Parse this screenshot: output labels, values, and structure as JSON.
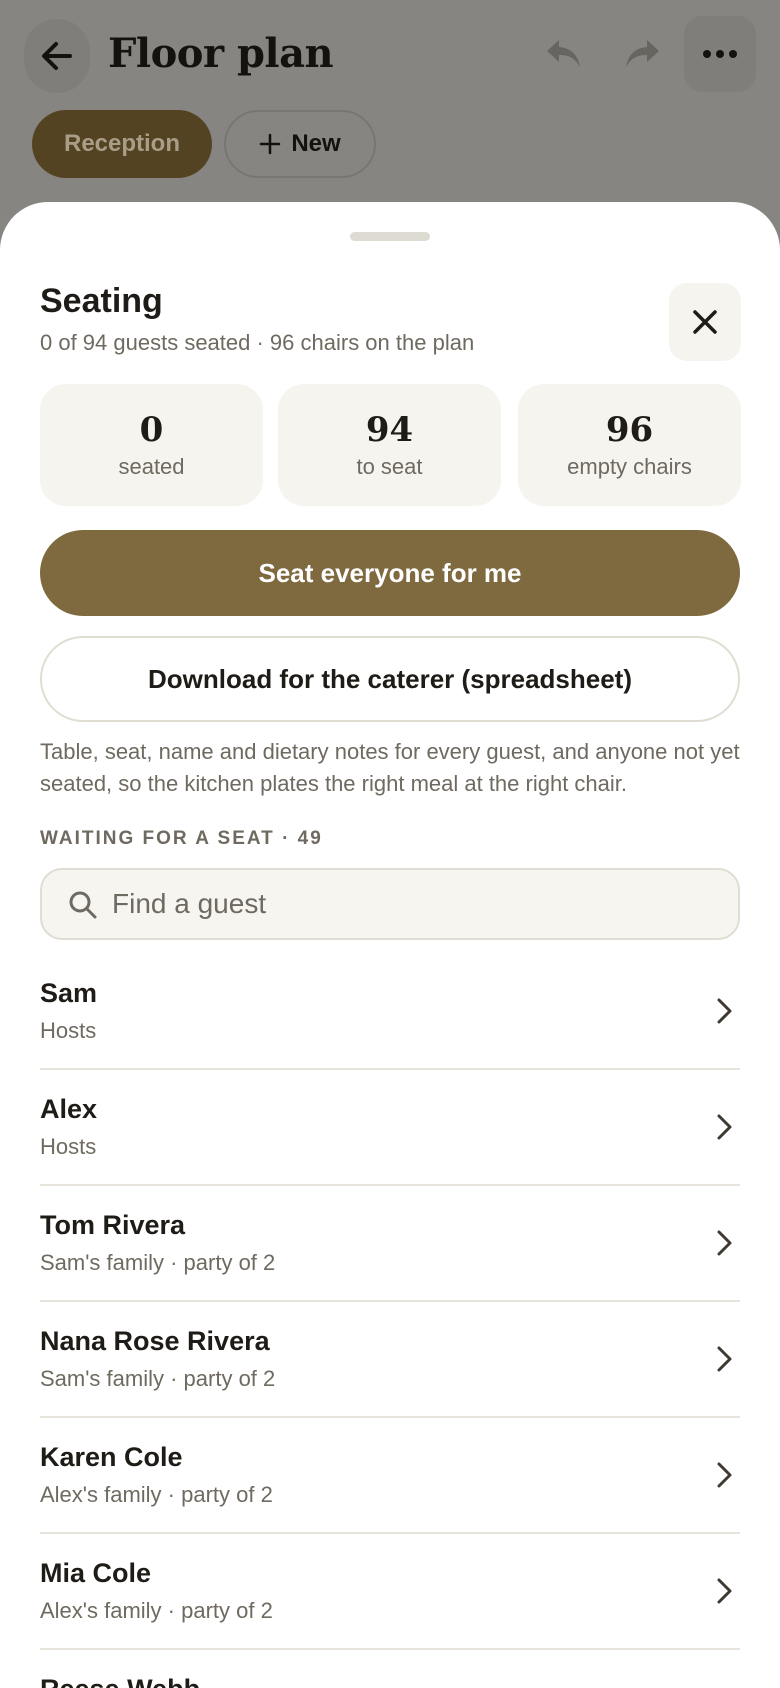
{
  "header": {
    "title": "Floor plan",
    "back_icon": "arrow-left-icon",
    "undo_icon": "undo-icon",
    "redo_icon": "redo-icon",
    "more_icon": "more-dots-icon",
    "chips": [
      {
        "label": "Reception"
      },
      {
        "label": "New",
        "icon": "plus-icon"
      }
    ]
  },
  "sheet": {
    "title": "Seating",
    "subtitle": "0 of 94 guests seated · 96 chairs on the plan",
    "close_icon": "close-icon",
    "stats": [
      {
        "value": "0",
        "label": "seated"
      },
      {
        "value": "94",
        "label": "to seat"
      },
      {
        "value": "96",
        "label": "empty chairs"
      }
    ],
    "primary_button": "Seat everyone for me",
    "secondary_button": "Download for the caterer (spreadsheet)",
    "help_text": "Table, seat, name and dietary notes for every guest, and anyone not yet seated, so the kitchen plates the right meal at the right chair.",
    "section_label": "WAITING FOR A SEAT · 49",
    "search": {
      "placeholder": "Find a guest",
      "icon": "search-icon"
    },
    "guests": [
      {
        "name": "Sam",
        "group": "Hosts"
      },
      {
        "name": "Alex",
        "group": "Hosts"
      },
      {
        "name": "Tom Rivera",
        "group": "Sam's family · party of 2"
      },
      {
        "name": "Nana Rose Rivera",
        "group": "Sam's family · party of 2"
      },
      {
        "name": "Karen Cole",
        "group": "Alex's family · party of 2"
      },
      {
        "name": "Mia Cole",
        "group": "Alex's family · party of 2"
      },
      {
        "name": "Reese Webb",
        "group": ""
      }
    ]
  },
  "colors": {
    "accent": "#7f6a3f",
    "chip_active": "#544322",
    "backdrop": "#868581",
    "card": "#f6f4ee",
    "muted_text": "#6f6a60"
  }
}
